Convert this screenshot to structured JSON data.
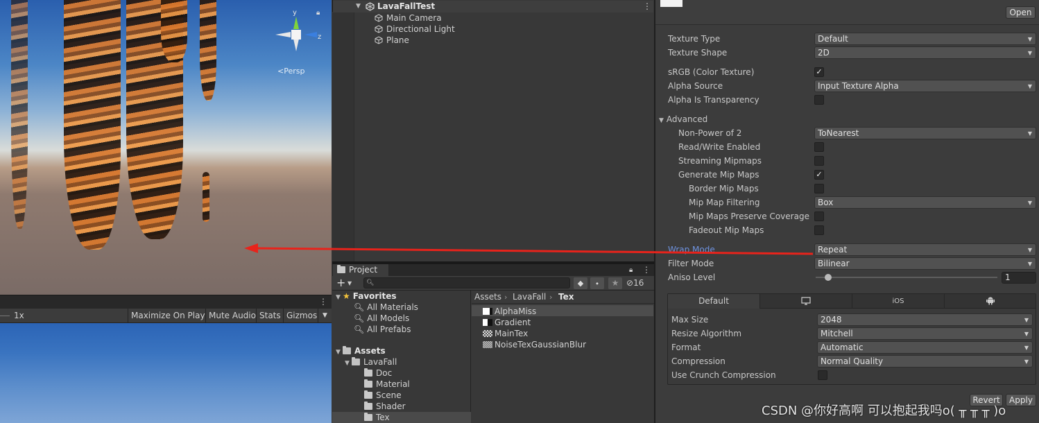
{
  "scene": {
    "view_label": "Persp",
    "gizmo_axes": {
      "y": "y",
      "z": "z"
    },
    "colors": {
      "y_axis": "#7fd43a",
      "z_axis": "#3a7fe0",
      "x_axis": "#e0e0e0"
    }
  },
  "game": {
    "scale": "1x",
    "toolbar": [
      "Maximize On Play",
      "Mute Audio",
      "Stats",
      "Gizmos"
    ]
  },
  "hierarchy": {
    "scene_name": "LavaFallTest",
    "items": [
      "Main Camera",
      "Directional Light",
      "Plane"
    ]
  },
  "project": {
    "tab_label": "Project",
    "hidden_count": "16",
    "favorites": {
      "label": "Favorites",
      "items": [
        "All Materials",
        "All Models",
        "All Prefabs"
      ]
    },
    "assets": {
      "label": "Assets",
      "lavafall": "LavaFall",
      "folders": [
        "Doc",
        "Material",
        "Scene",
        "Shader",
        "Tex"
      ]
    },
    "breadcrumb": [
      "Assets",
      "LavaFall",
      "Tex"
    ],
    "files": [
      "AlphaMiss",
      "Gradient",
      "MainTex",
      "NoiseTexGaussianBlur"
    ]
  },
  "inspector": {
    "open_label": "Open",
    "texture_type": {
      "label": "Texture Type",
      "value": "Default"
    },
    "texture_shape": {
      "label": "Texture Shape",
      "value": "2D"
    },
    "srgb": {
      "label": "sRGB (Color Texture)",
      "checked": "✓"
    },
    "alpha_source": {
      "label": "Alpha Source",
      "value": "Input Texture Alpha"
    },
    "alpha_is_transparency": {
      "label": "Alpha Is Transparency"
    },
    "advanced": {
      "label": "Advanced"
    },
    "non_power_of_2": {
      "label": "Non-Power of 2",
      "value": "ToNearest"
    },
    "read_write": {
      "label": "Read/Write Enabled"
    },
    "streaming_mipmaps": {
      "label": "Streaming Mipmaps"
    },
    "generate_mip_maps": {
      "label": "Generate Mip Maps",
      "checked": "✓"
    },
    "border_mip_maps": {
      "label": "Border Mip Maps"
    },
    "mip_map_filtering": {
      "label": "Mip Map Filtering",
      "value": "Box"
    },
    "mip_maps_preserve_coverage": {
      "label": "Mip Maps Preserve Coverage"
    },
    "fadeout_mip_maps": {
      "label": "Fadeout Mip Maps"
    },
    "wrap_mode": {
      "label": "Wrap Mode",
      "value": "Repeat"
    },
    "filter_mode": {
      "label": "Filter Mode",
      "value": "Bilinear"
    },
    "aniso_level": {
      "label": "Aniso Level",
      "value": "1"
    },
    "platform_tabs": {
      "default": "Default",
      "ios": "iOS"
    },
    "max_size": {
      "label": "Max Size",
      "value": "2048"
    },
    "resize_algorithm": {
      "label": "Resize Algorithm",
      "value": "Mitchell"
    },
    "format": {
      "label": "Format",
      "value": "Automatic"
    },
    "compression": {
      "label": "Compression",
      "value": "Normal Quality"
    },
    "use_crunch": {
      "label": "Use Crunch Compression"
    },
    "revert_label": "Revert",
    "apply_label": "Apply"
  },
  "watermark": "CSDN @你好高啊 可以抱起我吗o( ╥ ╥ ╥ )o",
  "annotation": {
    "arrow_color": "#e8231b"
  }
}
